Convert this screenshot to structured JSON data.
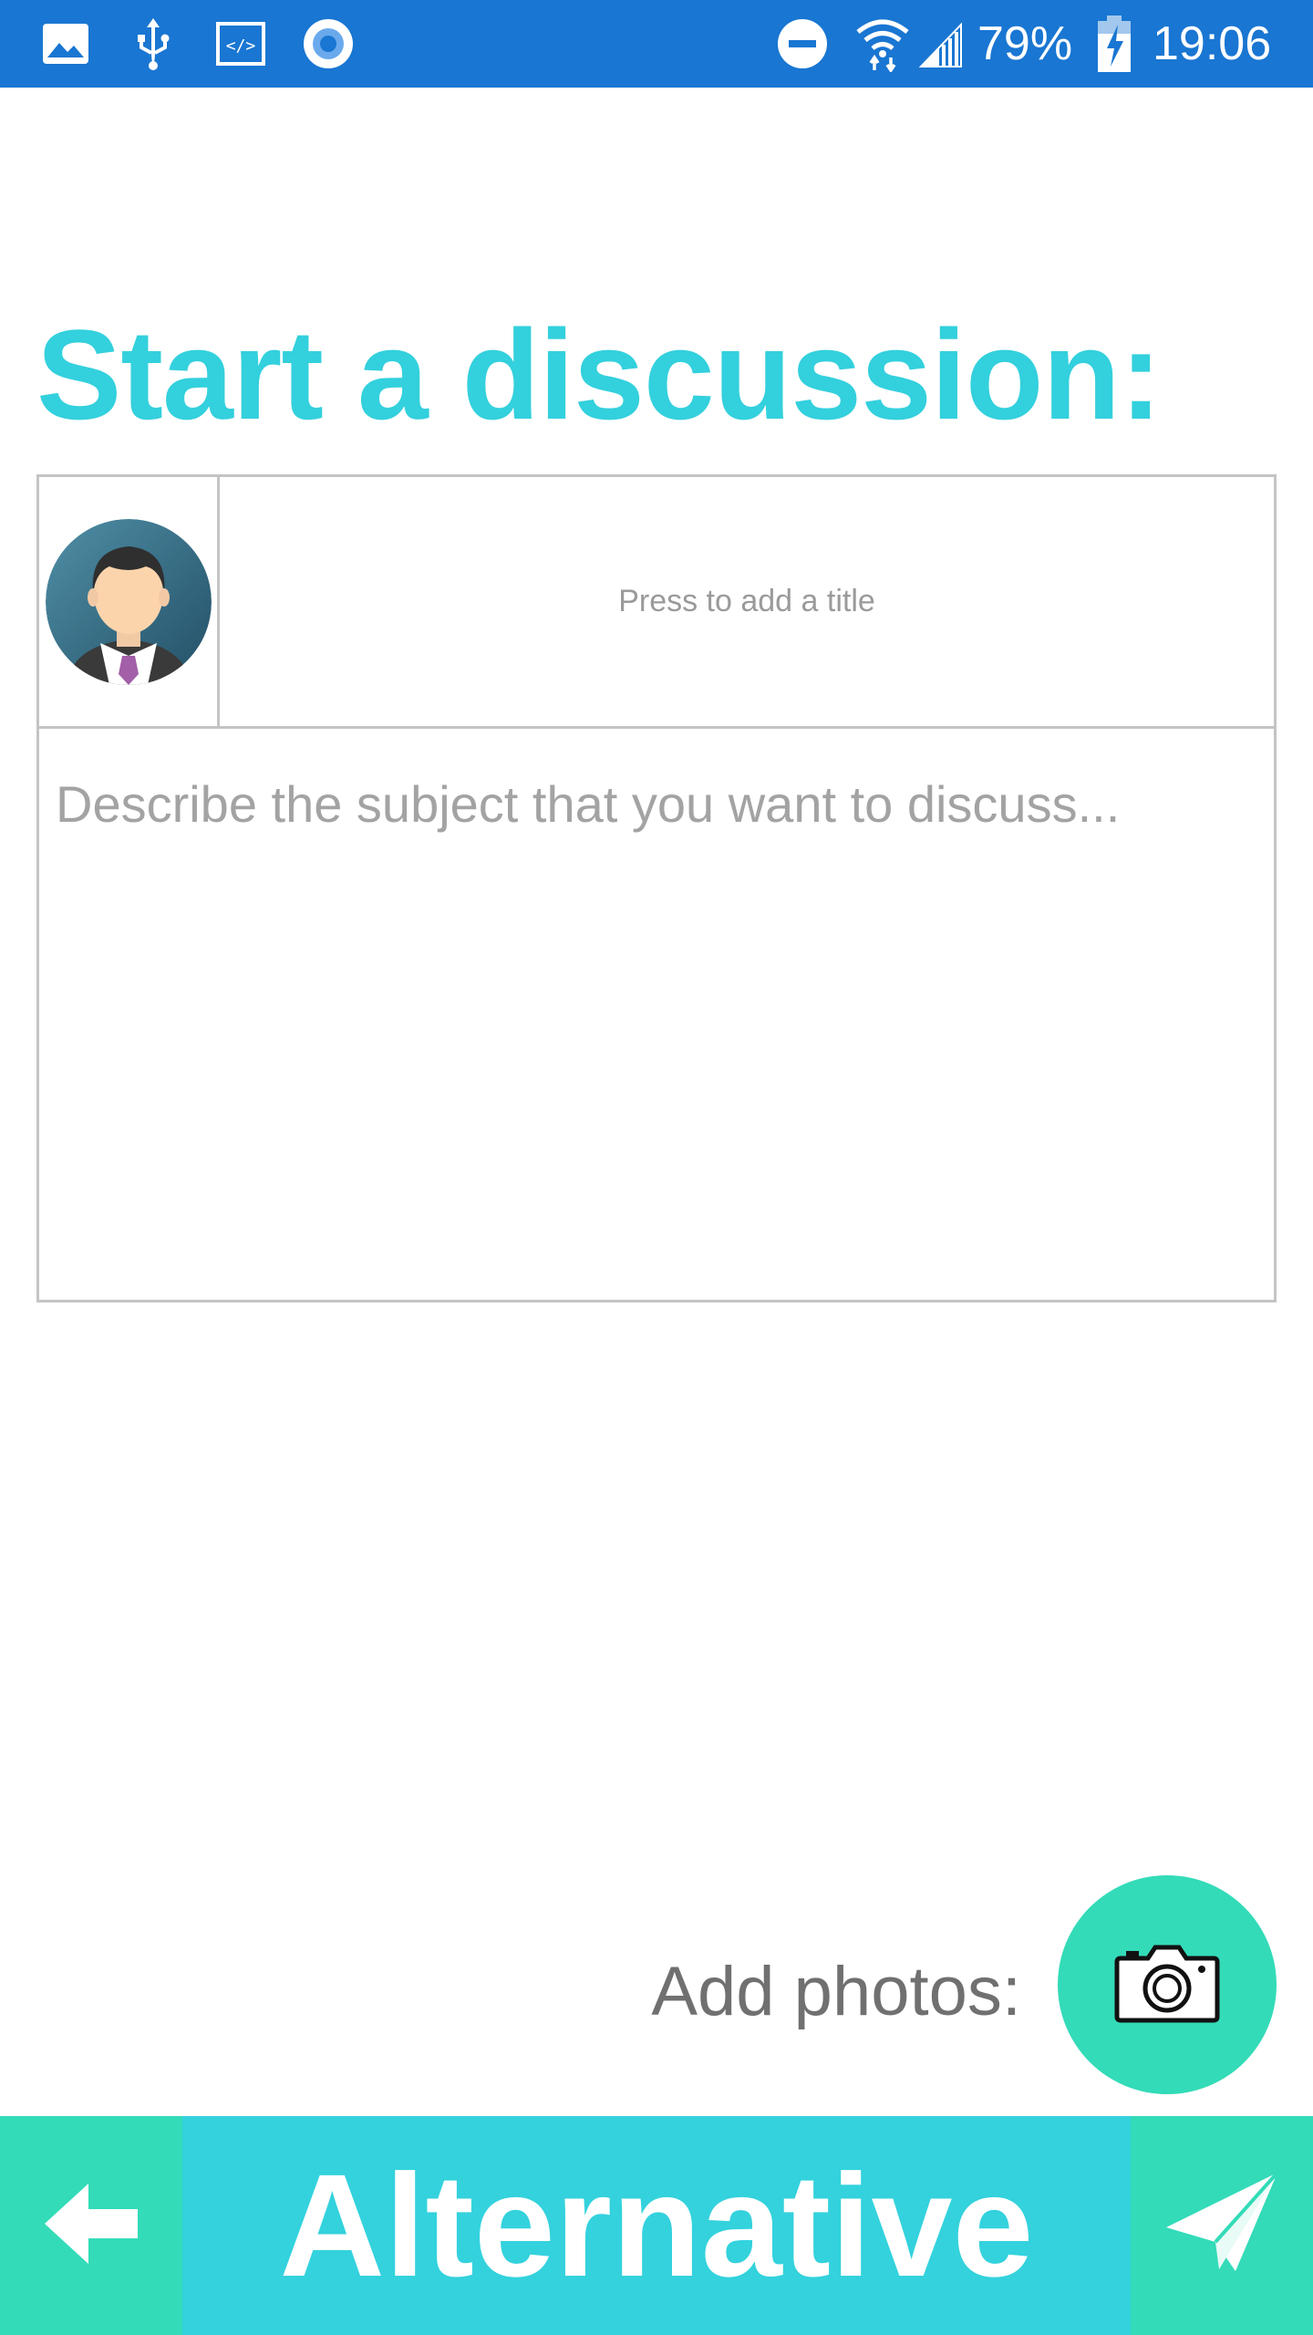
{
  "status_bar": {
    "battery_percent": "79%",
    "time": "19:06",
    "left_icons": [
      "image-icon",
      "usb-icon",
      "code-icon",
      "radio-icon"
    ],
    "right_icons": [
      "do-not-disturb-icon",
      "wifi-icon",
      "signal-icon",
      "battery-charging-icon"
    ],
    "background_color": "#1976d2"
  },
  "main": {
    "title": "Start a discussion:",
    "title_color": "#33d0dd",
    "title_input": {
      "placeholder": "Press to add a title",
      "value": ""
    },
    "description_input": {
      "placeholder": "Describe the subject that you want to discuss...",
      "value": ""
    },
    "avatar_icon": "user-avatar-icon"
  },
  "add_photos": {
    "label": "Add photos:",
    "button_icon": "camera-icon",
    "button_color": "#33dbb8"
  },
  "bottom_bar": {
    "title": "Alternative",
    "back_icon": "arrow-left-icon",
    "send_icon": "paper-plane-icon",
    "side_color": "#33dbb8",
    "center_color": "#33d2dd"
  }
}
